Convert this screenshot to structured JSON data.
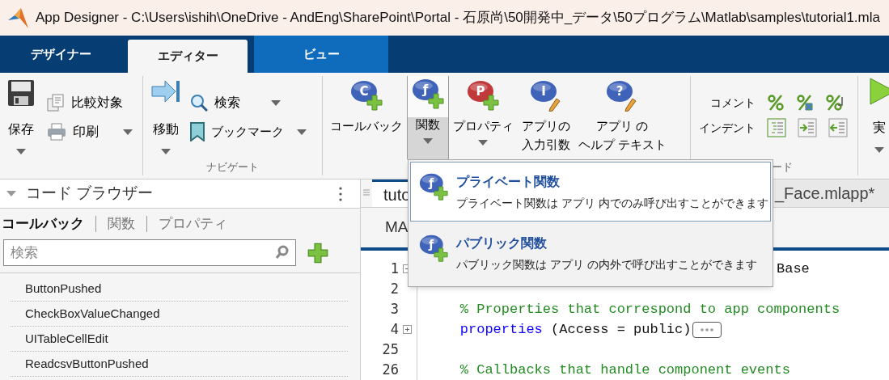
{
  "window": {
    "title": "App Designer - C:\\Users\\ishih\\OneDrive - AndEng\\SharePoint\\Portal - 石原尚\\50開発中_データ\\50プログラム\\Matlab\\samples\\tutorial1.mla"
  },
  "ribbon_tabs": [
    {
      "label": "デザイナー",
      "selected": false,
      "highlighted": false
    },
    {
      "label": "エディター",
      "selected": true,
      "highlighted": false
    },
    {
      "label": "ビュー",
      "selected": false,
      "highlighted": true
    }
  ],
  "ribbon": {
    "file": {
      "items": [
        {
          "label": "保存",
          "dropdown": true
        },
        {
          "label": "比較対象",
          "dropdown": false
        },
        {
          "label": "印刷",
          "dropdown": true
        }
      ]
    },
    "navigate": {
      "label": "ナビゲート",
      "items": [
        {
          "label": "移動",
          "dropdown": true
        },
        {
          "label": "検索",
          "dropdown": true
        },
        {
          "label": "ブックマーク",
          "dropdown": true
        }
      ]
    },
    "insert": {
      "items": [
        {
          "lines": [
            "コールバック"
          ],
          "glyph": "C",
          "color": "#3f63b8",
          "dropdown": false,
          "pressed": false
        },
        {
          "lines": [
            "関数"
          ],
          "glyph": "ƒ",
          "color": "#3f63b8",
          "dropdown": true,
          "pressed": true
        },
        {
          "lines": [
            "プロパティ"
          ],
          "glyph": "P",
          "color": "#c0393b",
          "dropdown": true,
          "pressed": false
        },
        {
          "lines": [
            "アプリの",
            "入力引数"
          ],
          "glyph": "I",
          "color": "#3f63b8",
          "dropdown": false,
          "pressed": false
        },
        {
          "lines": [
            "アプリ の",
            "ヘルプ テキスト"
          ],
          "glyph": "?",
          "color": "#3f63b8",
          "dropdown": false,
          "pressed": false
        }
      ]
    },
    "code": {
      "label": "ード",
      "rows": [
        "コメント",
        "インデント"
      ]
    },
    "run": {
      "label": "実",
      "dropdown": true
    }
  },
  "code_browser": {
    "title": "コード ブラウザー",
    "tabs": [
      {
        "label": "コールバック",
        "selected": true
      },
      {
        "label": "関数",
        "selected": false
      },
      {
        "label": "プロパティ",
        "selected": false
      }
    ],
    "search": {
      "placeholder": "検索"
    },
    "items": [
      "ButtonPushed",
      "CheckBoxValueChanged",
      "UITableCellEdit",
      "ReadcsvButtonPushed"
    ]
  },
  "editor": {
    "tabs": [
      {
        "label": "tuto",
        "selected": true
      },
      {
        "label": "_Face.mlapp*",
        "selected": false
      }
    ],
    "view_label": "MA",
    "lines": [
      {
        "number": "1",
        "expanded": true,
        "segments": [
          {
            "kind": "plain",
            "text": "Base"
          }
        ]
      },
      {
        "number": "2"
      },
      {
        "number": "3",
        "segments": [
          {
            "kind": "comment",
            "text": "    % Properties that correspond to app components"
          }
        ]
      },
      {
        "number": "4",
        "expanded": false,
        "segments": [
          {
            "kind": "keyword",
            "text": "    properties"
          },
          {
            "kind": "plain",
            "text": " (Access = public)"
          },
          {
            "kind": "folded"
          }
        ]
      },
      {
        "number": "25"
      },
      {
        "number": "26",
        "segments": [
          {
            "kind": "comment",
            "text": "    % Callbacks that handle component events"
          }
        ]
      }
    ]
  },
  "function_menu": {
    "items": [
      {
        "glyph": "ƒ",
        "title": "プライベート関数",
        "description": "プライベート関数は アプリ 内でのみ呼び出すことができます",
        "selected": true
      },
      {
        "glyph": "ƒ",
        "title": "パブリック関数",
        "description": "パブリック関数は アプリ の内外で呼び出すことができます",
        "selected": false
      }
    ]
  }
}
